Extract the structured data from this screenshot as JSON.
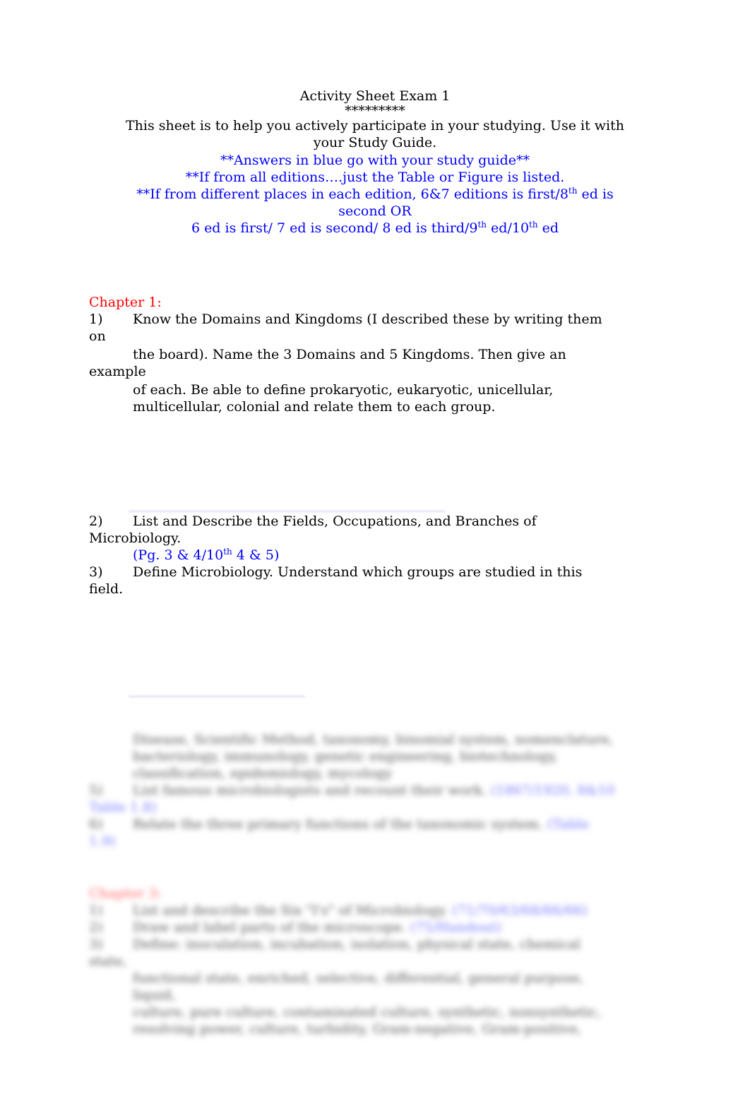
{
  "header": {
    "title": "Activity Sheet Exam 1",
    "stars": "*********",
    "intro_line1": "This sheet is to help you actively participate in your studying.  Use it with",
    "intro_line2": "your Study Guide.",
    "note1": "**Answers in blue go with your study guide**",
    "note2": "**If from all editions….just the Table or Figure is listed.",
    "note3_a": "**If from different places in each edition, 6&7 editions is first/8",
    "note3_sup": "th",
    "note3_b": " ed is",
    "note3_line2": "second OR",
    "note4_a": "6 ed is first/ 7 ed is second/ 8 ed is third/9",
    "note4_sup1": "th",
    "note4_b": " ed/10",
    "note4_sup2": "th",
    "note4_c": " ed"
  },
  "chapter1": {
    "heading": "Chapter 1:",
    "q1": {
      "num": "1)",
      "line1": "Know the Domains and Kingdoms (I described these by writing them",
      "line1_wrap": "on",
      "line2": "the board).  Name the 3 Domains and 5 Kingdoms.  Then give an",
      "line2_wrap": "example",
      "line3": "of each.  Be able to define prokaryotic, eukaryotic, unicellular,",
      "line4": "multicellular, colonial and relate them to each group."
    },
    "q2": {
      "num": "2)",
      "line1": "List and Describe the Fields, Occupations, and Branches of",
      "line1_wrap": "Microbiology.",
      "ref_a": "(Pg. 3 & 4/10",
      "ref_sup": "th",
      "ref_b": " 4 & 5)"
    },
    "q3": {
      "num": "3)",
      "line1": "Define Microbiology.  Understand which groups are studied in this",
      "line1_wrap": "field."
    }
  },
  "blurred": {
    "terms_line1": "Disease, Scientific Method, taxonomy, binomial system, nomenclature,",
    "terms_line2": "bacteriology, immunology, genetic engineering, biotechnology,",
    "terms_line3": "classification, epidemiology, mycology",
    "q5_num": "5)",
    "q5_text": "List famous microbiologists and recount their work.",
    "q5_ref": "(1867/1920, 8&10",
    "q5_ref_wrap": "Table 1.8)",
    "q6_num": "6)",
    "q6_text": "Relate the three primary functions of the taxonomic system.",
    "q6_ref": "(Table",
    "q6_ref_wrap": "1.9)",
    "chapter3_heading": "Chapter 3:",
    "c3_q1_num": "1)",
    "c3_q1_text": "List and describe the Six \"I's\" of Microbiology.",
    "c3_q1_ref": "(71/70/63/68/66/66)",
    "c3_q2_num": "2)",
    "c3_q2_text": "Draw and label parts of the microscope.",
    "c3_q2_ref": "(75/Handout)",
    "c3_q3_num": "3)",
    "c3_q3_text": "Define:  inoculation, incubation, isolation, physical state, chemical",
    "c3_q3_wrap": "state,",
    "c3_q3_line2": "functional state, enriched, selective, differential, general purpose,",
    "c3_q3_line2_wrap": "liquid,",
    "c3_q3_line3": "culture, pure culture, contaminated culture, synthetic, nonsynthetic,",
    "c3_q3_line4": "resolving power, culture, turbidity, Gram-negative, Gram-positive,"
  }
}
